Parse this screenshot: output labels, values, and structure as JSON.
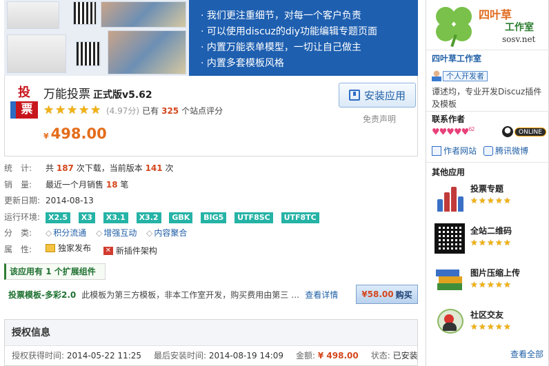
{
  "banner": {
    "lines": [
      "我们更注重细节，对每一个客户负责",
      "可以使用discuz的diy功能编辑专题页面",
      "内置万能表单模型，一切让自己做主",
      "内置多套模板风格"
    ]
  },
  "app": {
    "logo_top": "投",
    "logo_bottom": "票",
    "title": "万能投票",
    "edition": "正式版v5.62",
    "score": "(4.97分)",
    "rated_prefix": "已有",
    "rated_count": "325",
    "rated_suffix": "个站点评分",
    "currency": "¥",
    "price": "498.00",
    "install_label": "安装应用",
    "disclaimer": "免责声明",
    "rating_value": 4.97,
    "rating_max": 5
  },
  "stats": {
    "stat_label": "统　计:",
    "stat_pre": "共",
    "downloads": "187",
    "stat_mid": "次下载，当前版本",
    "version_downloads": "141",
    "stat_end": "次",
    "sales_label": "销　量:",
    "sales_pre": "最近一个月销售",
    "sales": "18",
    "sales_end": "笔",
    "update_label": "更新日期:",
    "update_date": "2014-08-13",
    "env_label": "运行环境:",
    "env_tags": [
      "X2.5",
      "X3",
      "X3.1",
      "X3.2",
      "GBK",
      "BIG5",
      "UTF8SC",
      "UTF8TC"
    ],
    "category_label": "分　类:",
    "categories": [
      "积分流通",
      "增强互动",
      "内容聚合"
    ],
    "attr_label": "属　性:",
    "attrs": [
      "独家发布",
      "新插件架构"
    ]
  },
  "extension": {
    "header_pre": "该应用有",
    "count": "1",
    "header_post": "个扩展组件",
    "name": "投票模板-多彩2.0",
    "desc": "此模板为第三方模板，非本工作室开发，购买费用由第三 …",
    "more": "查看详情",
    "price": "¥58.00",
    "buy": "购买"
  },
  "auth": {
    "title": "授权信息",
    "obtained_label": "授权获得时间:",
    "obtained": "2014-05-22 11:25",
    "last_install_label": "最后安装时间:",
    "last_install": "2014-08-19 14:09",
    "amount_label": "金额:",
    "amount": "¥ 498.00",
    "status_label": "状态:",
    "status": "已安装"
  },
  "sidebar": {
    "brand_cn": "四叶草",
    "brand_sub": "工作室",
    "brand_url": "sosv.net",
    "author_name": "四叶草工作室",
    "dev_badge": "个人开发者",
    "author_desc": "谭述均，专业开发Discuz插件及模板",
    "contact_title": "联系作者",
    "hearts_count": "62",
    "online_label": "ONLINE",
    "website": "作者网站",
    "weibo": "腾讯微博",
    "other_title": "其他应用",
    "apps": [
      {
        "name": "投票专题"
      },
      {
        "name": "全站二维码"
      },
      {
        "name": "图片压缩上传"
      },
      {
        "name": "社区交友"
      }
    ],
    "see_all": "查看全部"
  },
  "colors": {
    "accent_blue": "#2160a6",
    "price_orange": "#e46d1a",
    "highlight_red": "#d4461c",
    "env_tag_teal": "#25b3a6",
    "banner_blue": "#1e5fb0"
  }
}
